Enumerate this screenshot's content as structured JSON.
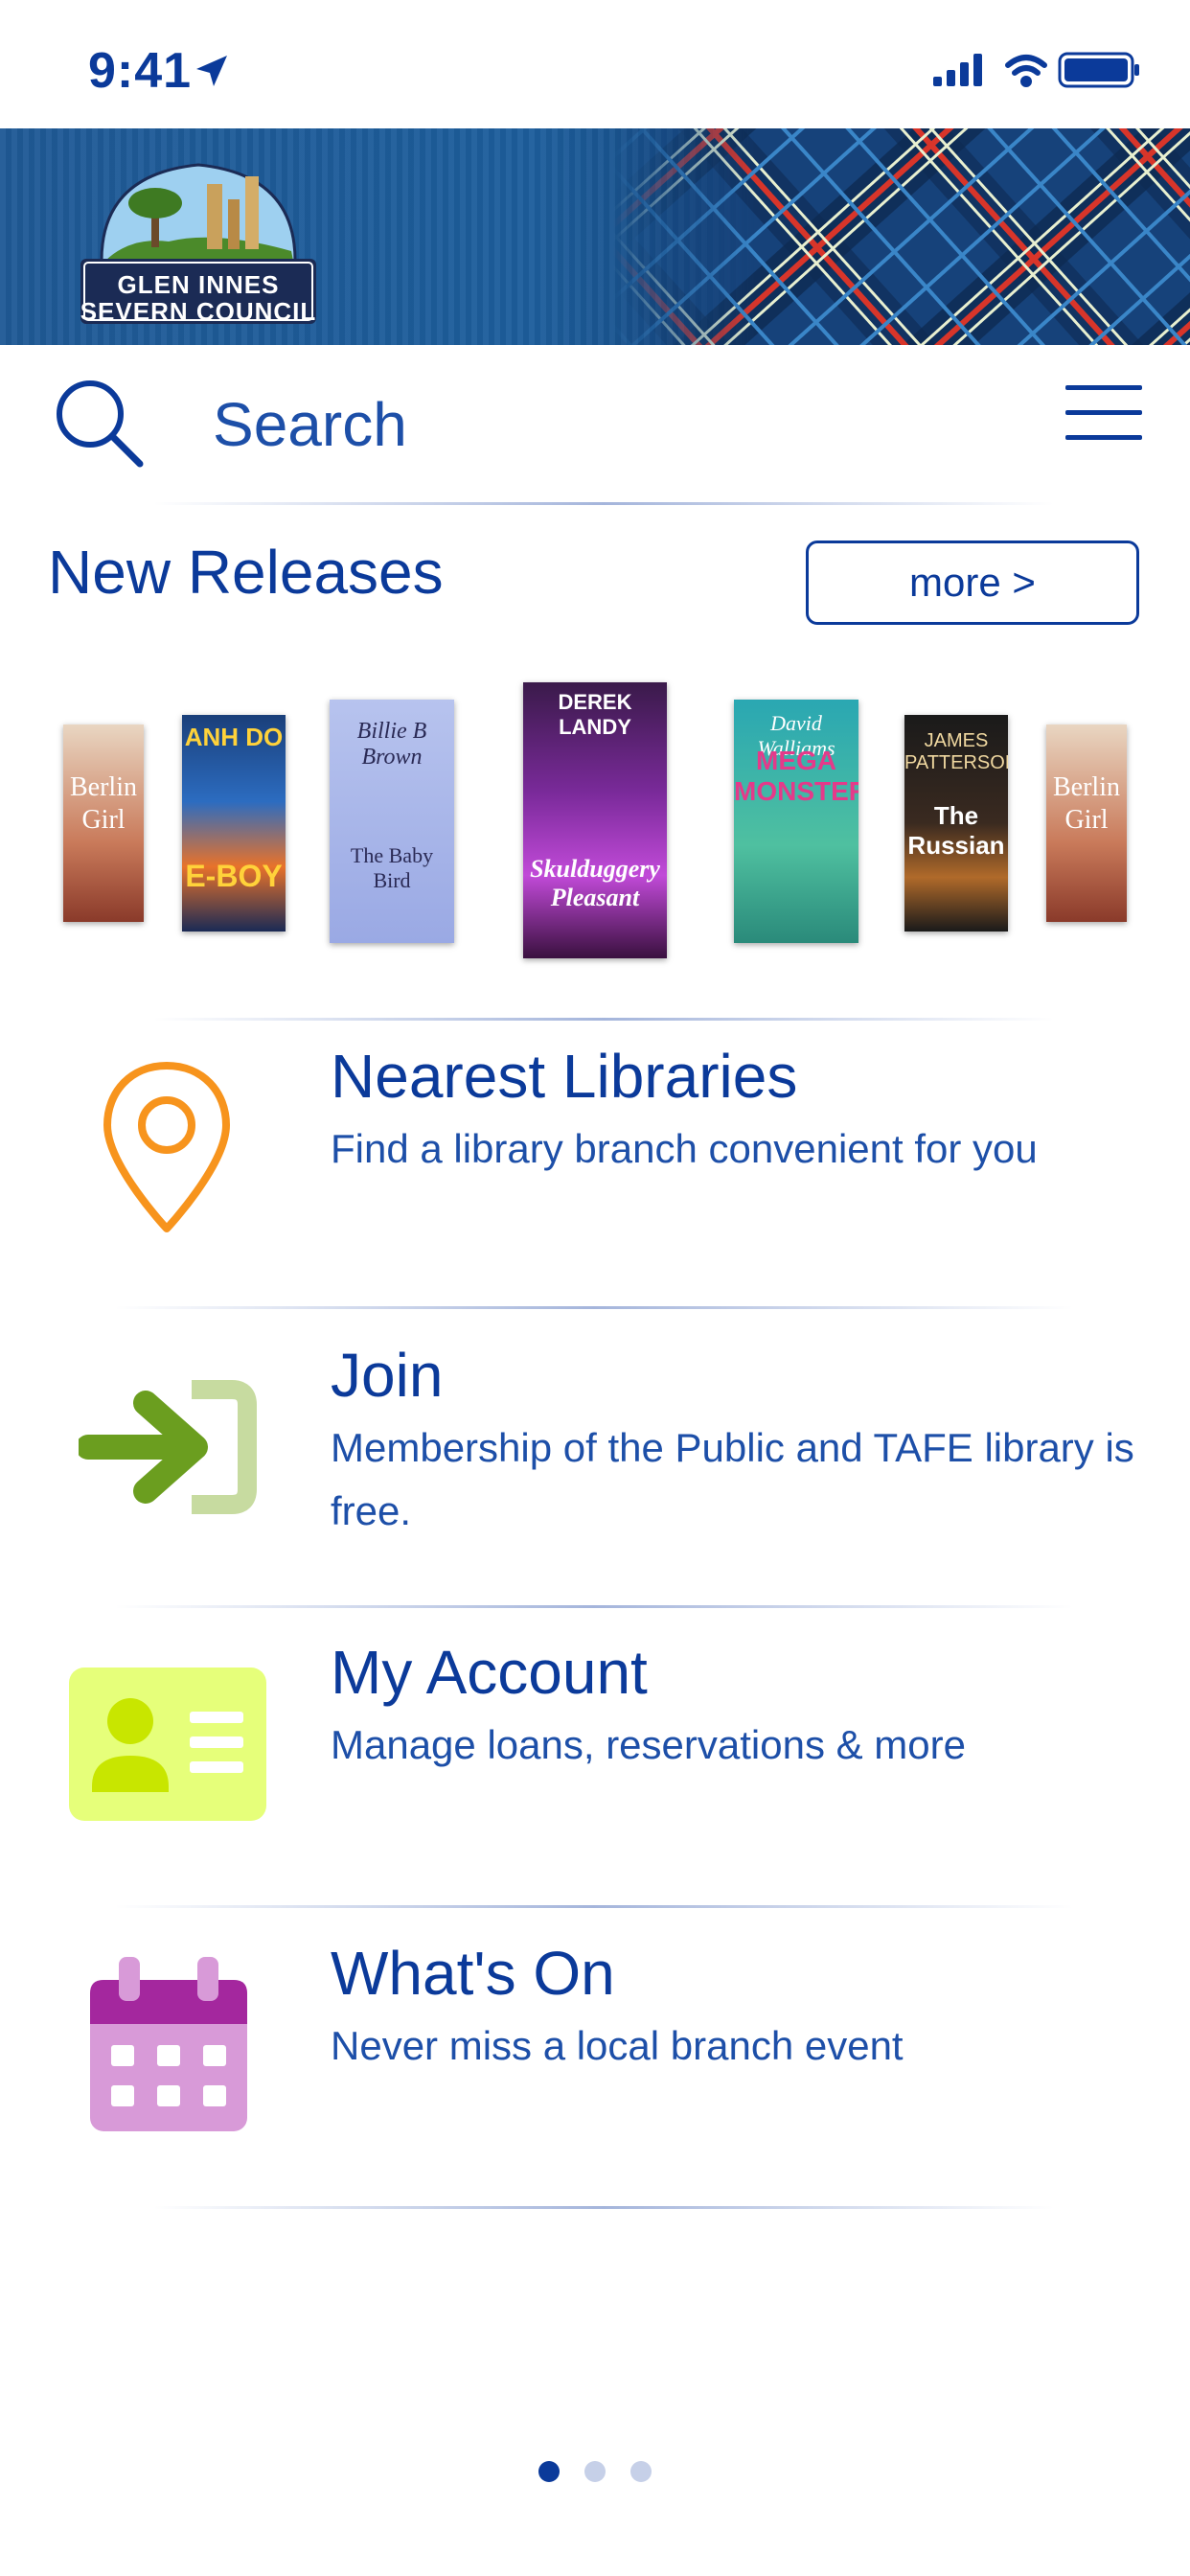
{
  "status_bar": {
    "time": "9:41"
  },
  "header": {
    "logo_line1": "GLEN INNES",
    "logo_line2": "SEVERN COUNCIL"
  },
  "search": {
    "placeholder": "Search"
  },
  "new_releases": {
    "title": "New Releases",
    "more_label": "more >",
    "books": [
      {
        "title_line1": "Berlin",
        "title_line2": "Girl"
      },
      {
        "title_line1": "ANH DO",
        "title_line2": "E-BOY"
      },
      {
        "title_line1": "Billie B Brown",
        "title_line2": "The Baby Bird"
      },
      {
        "title_line1": "DEREK LANDY",
        "title_line2": "Skulduggery Pleasant"
      },
      {
        "title_line1": "David Walliams",
        "title_line2": "MEGA MONSTER"
      },
      {
        "title_line1": "JAMES PATTERSON",
        "title_line2": "The Russian"
      },
      {
        "title_line1": "Berlin",
        "title_line2": "Girl"
      }
    ]
  },
  "features": [
    {
      "title": "Nearest Libraries",
      "subtitle": "Find a library branch convenient for you",
      "icon": "location-pin-icon"
    },
    {
      "title": "Join",
      "subtitle": "Membership of the Public and TAFE library is free.",
      "icon": "sign-in-icon"
    },
    {
      "title": "My Account",
      "subtitle": "Manage loans, reservations & more",
      "icon": "id-card-icon"
    },
    {
      "title": "What's On",
      "subtitle": "Never miss a local branch event",
      "icon": "calendar-icon"
    }
  ],
  "colors": {
    "primary": "#0b3a9a",
    "orange": "#f7941d",
    "green": "#6b9e1f",
    "lime": "#e6ff7a",
    "purple": "#a4279e"
  },
  "pagination": {
    "pages": 3,
    "active": 1
  }
}
